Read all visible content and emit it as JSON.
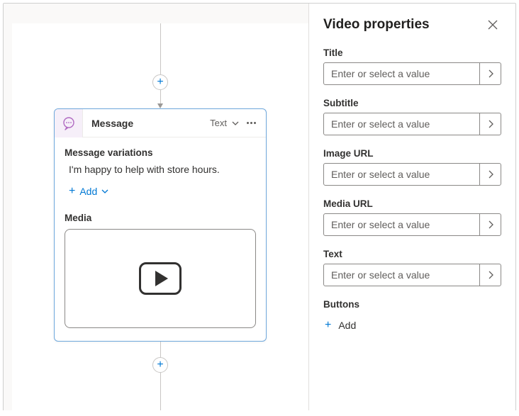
{
  "canvas": {
    "node": {
      "title": "Message",
      "mode_label": "Text",
      "variations_heading": "Message variations",
      "variation_text": "I'm happy to help with store hours.",
      "add_label": "Add",
      "media_heading": "Media"
    }
  },
  "panel": {
    "title": "Video properties",
    "placeholder": "Enter or select a value",
    "fields": {
      "title_label": "Title",
      "subtitle_label": "Subtitle",
      "image_url_label": "Image URL",
      "media_url_label": "Media URL",
      "text_label": "Text"
    },
    "buttons_heading": "Buttons",
    "add_label": "Add"
  }
}
